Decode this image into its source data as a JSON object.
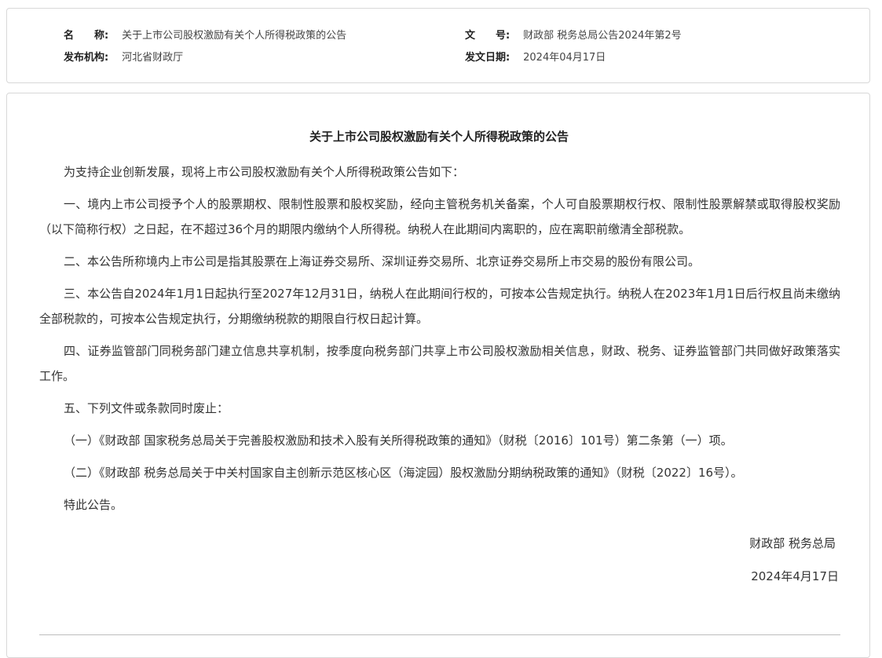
{
  "meta": {
    "name_key": "名　　称:",
    "name_val": "关于上市公司股权激励有关个人所得税政策的公告",
    "docno_key": "文　　号:",
    "docno_val": "财政部 税务总局公告2024年第2号",
    "issuer_key": "发布机构:",
    "issuer_val": "河北省财政厅",
    "date_key": "发文日期:",
    "date_val": "2024年04月17日"
  },
  "document": {
    "title": "关于上市公司股权激励有关个人所得税政策的公告",
    "paragraphs": [
      "为支持企业创新发展，现将上市公司股权激励有关个人所得税政策公告如下：",
      "一、境内上市公司授予个人的股票期权、限制性股票和股权奖励，经向主管税务机关备案，个人可自股票期权行权、限制性股票解禁或取得股权奖励（以下简称行权）之日起，在不超过36个月的期限内缴纳个人所得税。纳税人在此期间内离职的，应在离职前缴清全部税款。",
      "二、本公告所称境内上市公司是指其股票在上海证券交易所、深圳证券交易所、北京证券交易所上市交易的股份有限公司。",
      "三、本公告自2024年1月1日起执行至2027年12月31日，纳税人在此期间行权的，可按本公告规定执行。纳税人在2023年1月1日后行权且尚未缴纳全部税款的，可按本公告规定执行，分期缴纳税款的期限自行权日起计算。",
      "四、证券监管部门同税务部门建立信息共享机制，按季度向税务部门共享上市公司股权激励相关信息，财政、税务、证券监管部门共同做好政策落实工作。",
      "五、下列文件或条款同时废止：",
      "（一）《财政部 国家税务总局关于完善股权激励和技术入股有关所得税政策的通知》（财税〔2016〕101号）第二条第（一）项。",
      "（二）《财政部 税务总局关于中关村国家自主创新示范区核心区（海淀园）股权激励分期纳税政策的通知》（财税〔2022〕16号）。",
      "特此公告。"
    ],
    "signer": "财政部  税务总局",
    "sign_date": "2024年4月17日"
  }
}
